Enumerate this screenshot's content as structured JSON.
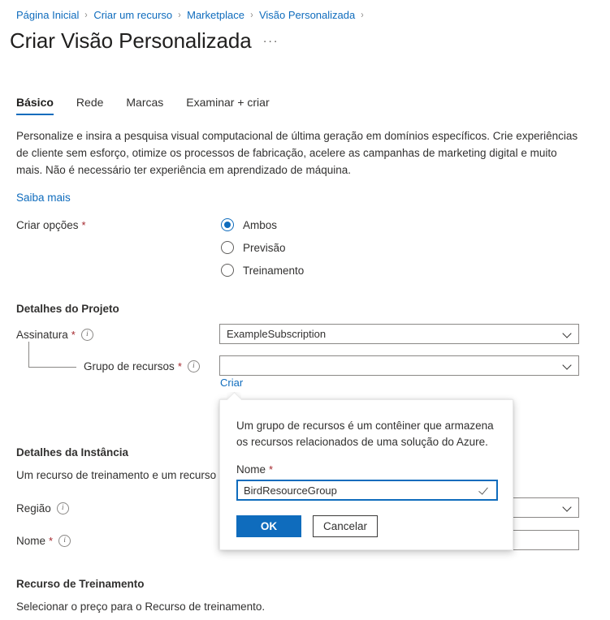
{
  "breadcrumb": {
    "items": [
      {
        "label": "Página Inicial"
      },
      {
        "label": "Criar um recurso"
      },
      {
        "label": "Marketplace"
      },
      {
        "label": "Visão Personalizada"
      }
    ],
    "separator": "›"
  },
  "header": {
    "title": "Criar Visão Personalizada",
    "more_actions": "···"
  },
  "tabs": [
    {
      "label": "Básico",
      "active": true
    },
    {
      "label": "Rede",
      "active": false
    },
    {
      "label": "Marcas",
      "active": false
    },
    {
      "label": "Examinar + criar",
      "active": false
    }
  ],
  "intro": {
    "paragraph": "Personalize e insira a pesquisa visual computacional de última geração em domínios específicos. Crie experiências de cliente sem esforço, otimize os processos de fabricação, acelere as campanhas de marketing digital e muito mais. Não é necessário ter experiência em aprendizado de máquina.",
    "learn_more": "Saiba mais"
  },
  "create_options": {
    "label": "Criar opções",
    "required_marker": "*",
    "options": [
      {
        "label": "Ambos",
        "selected": true
      },
      {
        "label": "Previsão",
        "selected": false
      },
      {
        "label": "Treinamento",
        "selected": false
      }
    ]
  },
  "project_details": {
    "heading": "Detalhes do Projeto",
    "subscription": {
      "label": "Assinatura",
      "required_marker": "*",
      "value": "ExampleSubscription"
    },
    "resource_group": {
      "label": "Grupo de recursos",
      "required_marker": "*",
      "value": "",
      "create_link": "Criar"
    }
  },
  "resource_group_callout": {
    "description": "Um grupo de recursos é um contêiner que armazena os recursos relacionados de uma solução do Azure.",
    "name_label": "Nome",
    "required_marker": "*",
    "name_value": "BirdResourceGroup",
    "ok_label": "OK",
    "cancel_label": "Cancelar"
  },
  "instance_details": {
    "heading": "Detalhes da Instância",
    "description": "Um recurso de treinamento e um recurso de",
    "region": {
      "label": "Região",
      "value": ""
    },
    "name": {
      "label": "Nome",
      "required_marker": "*",
      "value": ""
    }
  },
  "training_resource": {
    "heading": "Recurso de Treinamento",
    "description": "Selecionar o preço para o Recurso de treinamento."
  },
  "colors": {
    "accent": "#0f6cbd",
    "required": "#a4262c",
    "text": "#323130",
    "border": "#8a8886"
  }
}
